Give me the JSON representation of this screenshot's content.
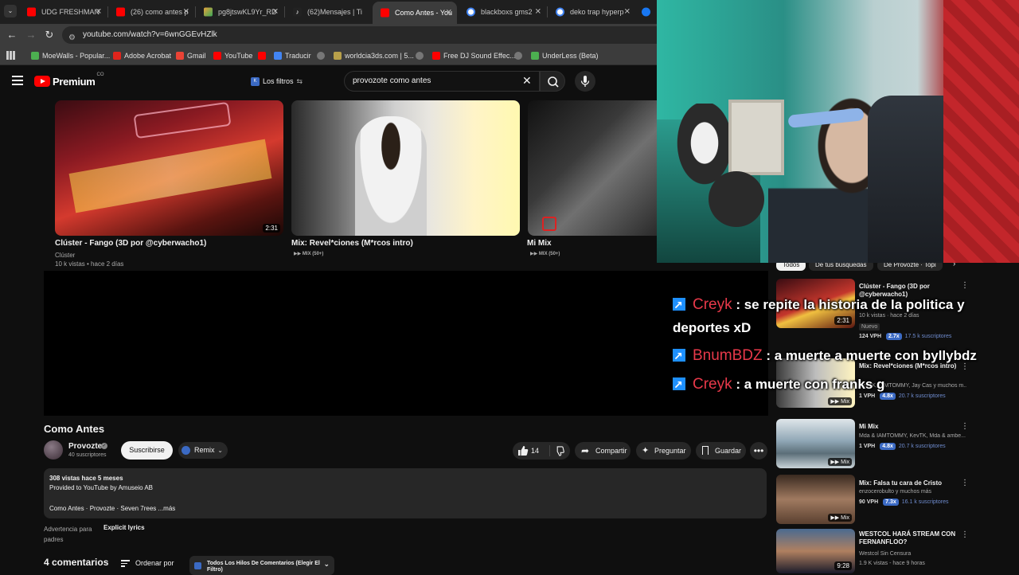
{
  "tabs": [
    {
      "title": "UDG FRESHMAN",
      "fav": "#ff0000"
    },
    {
      "title": "(26) como antes p",
      "fav": "#ff0000"
    },
    {
      "title": "pg8jtswKL9Yr_RD",
      "fav": "#e8a33c"
    },
    {
      "title": "(62)Mensajes | Ti",
      "fav": "#222222"
    },
    {
      "title": "Como Antes - You",
      "fav": "#ff0000"
    },
    {
      "title": "blackboxs gms2",
      "fav": "#4285f4"
    },
    {
      "title": "deko trap hyperp",
      "fav": "#4285f4"
    },
    {
      "title": "",
      "fav": "#1877f2"
    }
  ],
  "address": {
    "url": "youtube.com/watch?v=6wnGGEvHZlk"
  },
  "bookmarks": [
    "MoeWalls - Popular...",
    "Adobe Acrobat",
    "Gmail",
    "YouTube",
    "",
    "Traducir",
    "",
    "worldcia3ds.com | 5...",
    "",
    "Free DJ Sound Effec...",
    "",
    "UnderLess (Beta)"
  ],
  "header": {
    "logo": "Premium",
    "logo_sup": "CO",
    "filters": "Los filtros",
    "search_value": "provozote como antes"
  },
  "grid": [
    {
      "title": "Clúster - Fango (3D por @cyberwacho1)",
      "channel": "Clúster",
      "meta": "10 k vistas • hace 2 días",
      "duration": "2:31"
    },
    {
      "title": "Mix: Revel*ciones (M*rcos intro)",
      "channel": "MIX (50+)"
    },
    {
      "title": "Mi Mix",
      "channel": "MIX (50+)"
    }
  ],
  "video": {
    "title": "Como Antes",
    "channel": "Provozte",
    "subs": "40 suscriptores",
    "subscribe": "Suscribirse",
    "remix": "Remix",
    "likes": "14",
    "share": "Compartir",
    "ask": "Preguntar",
    "save": "Guardar",
    "views_line": "308 vistas  hace 5 meses",
    "provided": "Provided to YouTube by Amuseio AB",
    "desc_line": "Como Antes · Provozte · Seven 7rees  ...más",
    "advert": "Advertencia para padres",
    "explicit": "Explicit lyrics",
    "comments": "4 comentarios",
    "order": "Ordenar por",
    "thread": "Todos Los Hilos De Comentarios (Elegir El Filtro)"
  },
  "right_chips": [
    "Todos",
    "De tus búsquedas",
    "De Provozte · Topi"
  ],
  "related": [
    {
      "title": "Clúster - Fango (3D por @cyberwacho1)",
      "meta1": "10 k vistas · hace 2 días",
      "tag": "Nuevo",
      "vph": "124 VPH",
      "x": "2.7x",
      "subs": "17.5 k suscriptores",
      "duration": "2:31"
    },
    {
      "title": "Mix: Revel*ciones (M*rcos intro)",
      "meta1": "KevTK, IAMTOMMY, Jay Cas y muchos m...",
      "vph": "1 VPH",
      "x": "4.8x",
      "subs": "20.7 k suscriptores",
      "duration": "Mix"
    },
    {
      "title": "Mi Mix",
      "meta1": "Mda & IAMTOMMY, KevTK, Mda & ambe...",
      "vph": "1 VPH",
      "x": "4.8x",
      "subs": "20.7 k suscriptores",
      "duration": "Mix"
    },
    {
      "title": "Mix: Falsa tu cara de Cristo",
      "meta1": "enzocerobulto y muchos más",
      "vph": "90 VPH",
      "x": "7.3x",
      "subs": "16.1 k suscriptores",
      "duration": "Mix"
    },
    {
      "title": "WESTCOL HARÁ STREAM CON FERNANFLOO?",
      "meta1": "Westcol Sin Censura",
      "meta2": "1.9 K vistas - hace 9 horas",
      "duration": "9:28"
    }
  ],
  "chat": [
    {
      "user": "Creyk",
      "msg": " : se repite la historia de la politica y",
      "cont": "deportes xD"
    },
    {
      "user": "BnumBDZ",
      "msg": " : a muerte a muerte con byllybdz"
    },
    {
      "user": "Creyk",
      "msg": " : a muerte con franks g"
    }
  ]
}
